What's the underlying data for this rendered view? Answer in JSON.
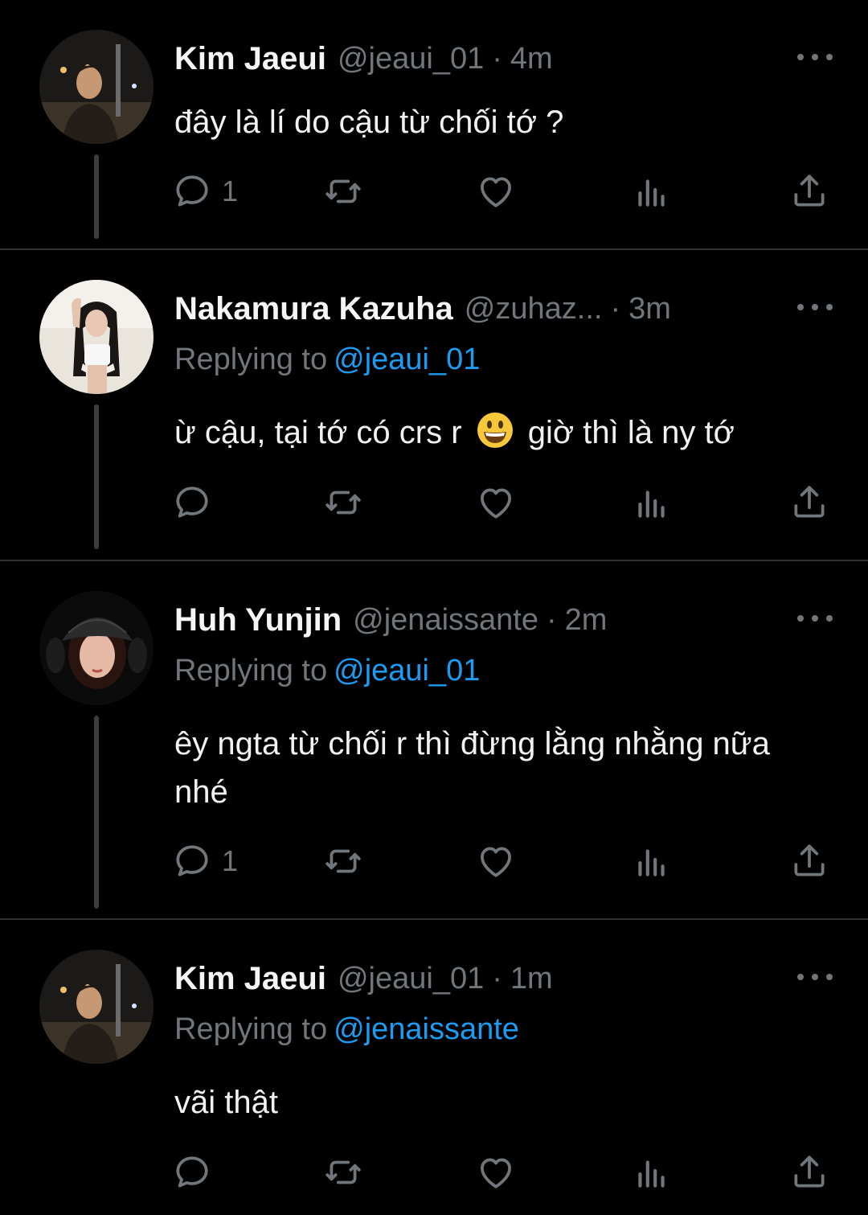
{
  "tweets": [
    {
      "name": "Kim Jaeui",
      "handle": "@jeaui_01",
      "time": "4m",
      "replying_prefix": "",
      "replying_to": "",
      "text": "đây là lí do cậu từ chối tớ ?",
      "reply_count": "1"
    },
    {
      "name": "Nakamura Kazuha",
      "handle": "@zuhaz...",
      "time": "3m",
      "replying_prefix": "Replying to",
      "replying_to": "@jeaui_01",
      "text_before_emoji": "ừ cậu, tại tớ có crs r",
      "emoji": "grinning-face",
      "text_after_emoji": "giờ thì là ny tớ",
      "reply_count": ""
    },
    {
      "name": "Huh Yunjin",
      "handle": "@jenaissante",
      "time": "2m",
      "replying_prefix": "Replying to",
      "replying_to": "@jeaui_01",
      "text": "êy ngta từ chối r thì đừng lằng nhằng nữa nhé",
      "reply_count": "1"
    },
    {
      "name": "Kim Jaeui",
      "handle": "@jeaui_01",
      "time": "1m",
      "replying_prefix": "Replying to",
      "replying_to": "@jenaissante",
      "text": "vãi thật",
      "reply_count": ""
    }
  ],
  "dot_separator": "·",
  "colors": {
    "background": "#000000",
    "text": "#e7e9ea",
    "muted": "#71767b",
    "link": "#1d9bf0",
    "divider": "#2f3336"
  },
  "icons": [
    "reply-icon",
    "retweet-icon",
    "like-icon",
    "analytics-icon",
    "share-icon",
    "more-icon"
  ]
}
